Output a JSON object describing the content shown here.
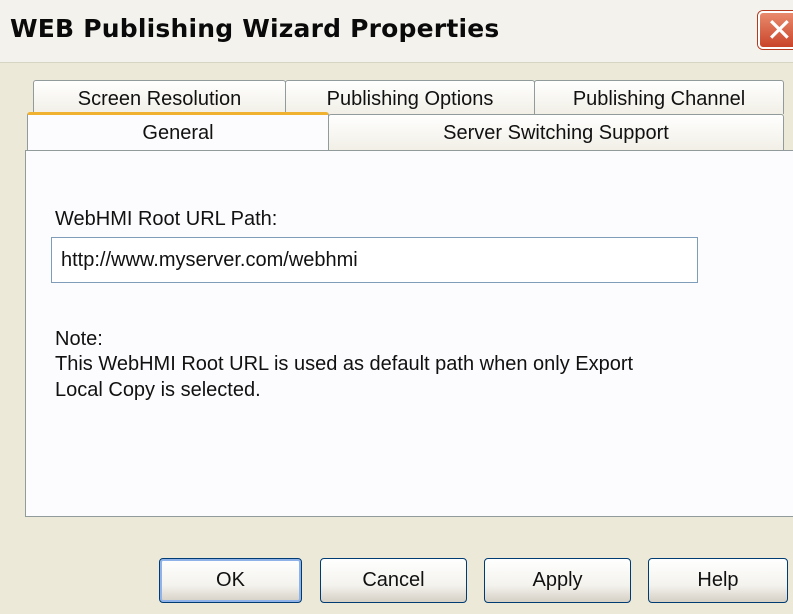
{
  "window": {
    "title": "WEB Publishing Wizard Properties",
    "close_symbol": "✕"
  },
  "tabs": {
    "row1": [
      "Screen Resolution",
      "Publishing Options",
      "Publishing Channel"
    ],
    "row2": [
      "General",
      "Server Switching Support"
    ],
    "active": "General"
  },
  "general": {
    "root_url_label": "WebHMI Root URL Path:",
    "root_url_value": "http://www.myserver.com/webhmi",
    "note_heading": "Note:",
    "note_line1": "This WebHMI Root URL is used as default path when only Export",
    "note_line2": "Local Copy is selected."
  },
  "buttons": {
    "ok": "OK",
    "cancel": "Cancel",
    "apply": "Apply",
    "help": "Help"
  },
  "colors": {
    "dialog_bg": "#ece9d8",
    "active_tab_accent": "#f0b030",
    "close_button": "#c9452a",
    "button_border": "#003c74"
  },
  "icons": {
    "close": "close-icon"
  }
}
